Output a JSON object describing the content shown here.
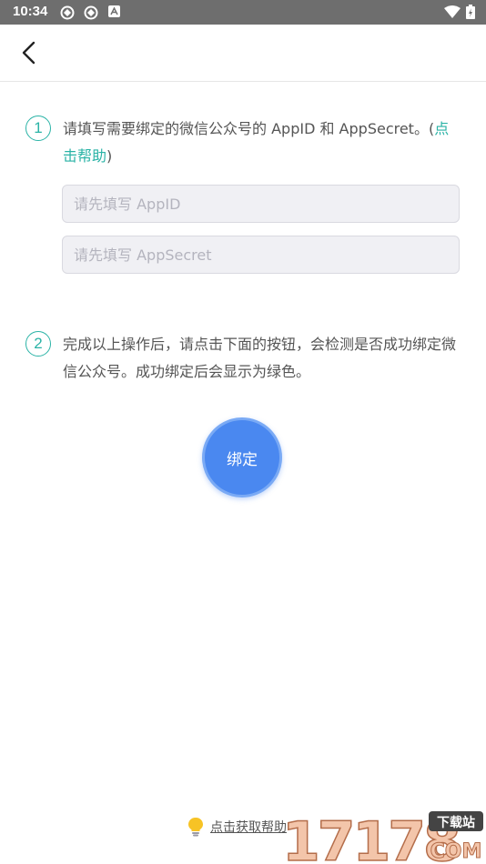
{
  "status_bar": {
    "time": "10:34"
  },
  "step1": {
    "number": "1",
    "text": "请填写需要绑定的微信公众号的 AppID 和 AppSecret。(",
    "link": "点击帮助",
    "text_end": ")"
  },
  "inputs": {
    "appid": {
      "placeholder": "请先填写 AppID",
      "value": ""
    },
    "appsecret": {
      "placeholder": "请先填写 AppSecret",
      "value": ""
    }
  },
  "step2": {
    "number": "2",
    "text": "完成以上操作后，请点击下面的按钮，会检测是否成功绑定微信公众号。成功绑定后会显示为绿色。"
  },
  "bind_button": {
    "label": "绑定"
  },
  "help": {
    "label": "点击获取帮助"
  },
  "watermark": {
    "text": "17178",
    "badge": "下载站",
    "domain": "COM"
  },
  "colors": {
    "accent": "#2ab3a6",
    "button": "#4a88f0",
    "status_bar": "#6e6e6e"
  }
}
